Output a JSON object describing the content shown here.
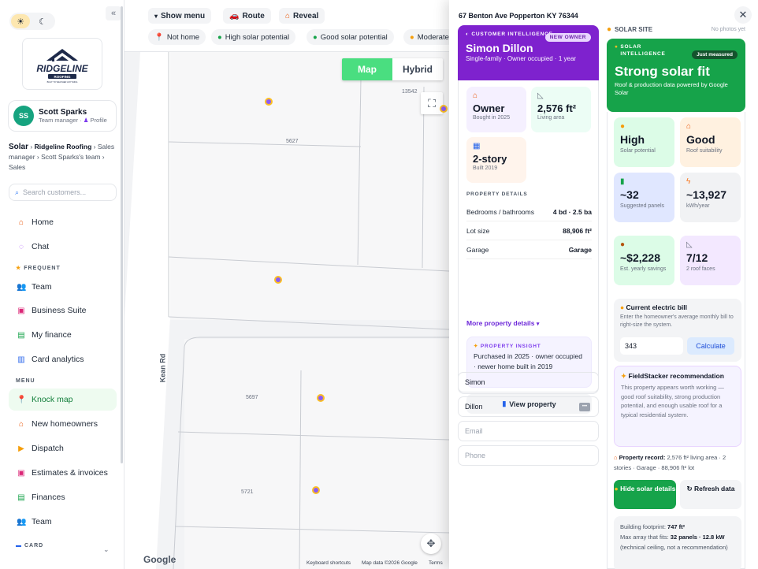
{
  "sidebar": {
    "collapse_icon": "«",
    "theme": {
      "light_icon": "sun-icon",
      "dark_icon": "moon-icon"
    },
    "logo": {
      "brand": "RIDGELINE",
      "sub": "ROOFING",
      "tagline": "BUILT TO WEATHER ANYTHING"
    },
    "user": {
      "initials": "SS",
      "name": "Scott Sparks",
      "role": "Team manager",
      "profile_label": "Profile"
    },
    "breadcrumb": {
      "root": "Solar",
      "org": "Ridgeline Roofing",
      "rest": "Sales manager › Scott Sparks's team › Sales"
    },
    "search_placeholder": "Search customers...",
    "items_top": [
      {
        "label": "Home",
        "icon": "home-icon"
      },
      {
        "label": "Chat",
        "icon": "chat-icon"
      }
    ],
    "section_frequent": "FREQUENT",
    "items_frequent": [
      {
        "label": "Team",
        "icon": "team-icon"
      },
      {
        "label": "Business Suite",
        "icon": "briefcase-icon"
      },
      {
        "label": "My finance",
        "icon": "money-icon"
      },
      {
        "label": "Card analytics",
        "icon": "chart-icon"
      }
    ],
    "section_menu": "MENU",
    "items_menu": [
      {
        "label": "Knock map",
        "icon": "map-pin-icon"
      },
      {
        "label": "New homeowners",
        "icon": "house-icon"
      },
      {
        "label": "Dispatch",
        "icon": "truck-icon"
      },
      {
        "label": "Estimates & invoices",
        "icon": "briefcase-icon"
      },
      {
        "label": "Finances",
        "icon": "money-icon"
      },
      {
        "label": "Team",
        "icon": "team-icon"
      }
    ],
    "section_card": "CARD"
  },
  "map": {
    "toolbar": {
      "show_menu": "Show menu",
      "route": "Route",
      "reveal": "Reveal"
    },
    "filters": [
      "Not home",
      "High solar potential",
      "Good solar potential",
      "Moderate"
    ],
    "map_type": {
      "map": "Map",
      "hybrid": "Hybrid",
      "selected": "Map"
    },
    "parcels": [
      "13542",
      "5627",
      "5697",
      "5721"
    ],
    "road": "Kean Rd",
    "google": "Google",
    "attribution": [
      "Keyboard shortcuts",
      "Map data ©2026 Google",
      "Terms"
    ]
  },
  "panel": {
    "address": "67 Benton Ave Popperton KY 76344",
    "close": "✕",
    "customer": {
      "tag": "CUSTOMER INTELLIGENCE",
      "badge": "NEW OWNER",
      "name": "Simon Dillon",
      "summary": "Single-family · Owner occupied · 1 year",
      "tiles": [
        {
          "value": "Owner",
          "label": "Bought in 2025",
          "icon": "house-icon"
        },
        {
          "value": "2,576 ft²",
          "label": "Living area",
          "icon": "ruler-icon"
        },
        {
          "value": "2-story",
          "label": "Built 2019",
          "icon": "building-icon"
        }
      ],
      "details_heading": "PROPERTY DETAILS",
      "details": [
        {
          "label": "Bedrooms / bathrooms",
          "value": "4 bd · 2.5 ba"
        },
        {
          "label": "Lot size",
          "value": "88,906 ft²"
        },
        {
          "label": "Garage",
          "value": "Garage"
        }
      ],
      "more_link": "More property details",
      "insight_heading": "PROPERTY INSIGHT",
      "insight_body": "Purchased in 2025 · owner occupied · newer home built in 2019",
      "view_button": "View property"
    },
    "form": {
      "first_name": "Simon",
      "last_name": "Dillon",
      "email_placeholder": "Email",
      "phone_placeholder": "Phone"
    },
    "solar": {
      "site_label": "SOLAR SITE",
      "no_photos": "No photos yet",
      "tag": "SOLAR INTELLIGENCE",
      "badge": "Just measured",
      "headline": "Strong solar fit",
      "desc": "Roof & production data powered by Google Solar",
      "tiles": [
        {
          "value": "High",
          "label": "Solar potential",
          "icon": "sun-icon"
        },
        {
          "value": "Good",
          "label": "Roof suitability",
          "icon": "house-icon"
        },
        {
          "value": "~32",
          "label": "Suggested panels",
          "icon": "battery-icon"
        },
        {
          "value": "~13,927",
          "label": "kWh/year",
          "icon": "bolt-icon"
        },
        {
          "value": "~$2,228",
          "label": "Est. yearly savings",
          "icon": "moneybag-icon"
        },
        {
          "value": "7/12",
          "label": "2 roof faces",
          "icon": "ruler-icon"
        }
      ],
      "bill": {
        "title": "Current electric bill",
        "desc": "Enter the homeowner's average monthly bill to right-size the system.",
        "value": "343",
        "button": "Calculate"
      },
      "recommendation": {
        "title": "FieldStacker recommendation",
        "body": "This property appears worth working — good roof suitability, strong production potential, and enough usable roof for a typical residential system."
      },
      "property_record": {
        "label": "Property record:",
        "value": "2,576 ft² living area · 2 stories · Garage · 88,906 ft² lot"
      },
      "hide_button": "Hide solar details",
      "refresh_button": "Refresh data",
      "footprint": {
        "line1_label": "Building footprint:",
        "line1_value": "747 ft²",
        "line2_label": "Max array that fits:",
        "line2_value": "32 panels · 12.8 kW",
        "line3": "(technical ceiling, not a recommendation)"
      }
    }
  },
  "colors": {
    "accent_green": "#16a34a",
    "accent_purple": "#7e22ce"
  }
}
